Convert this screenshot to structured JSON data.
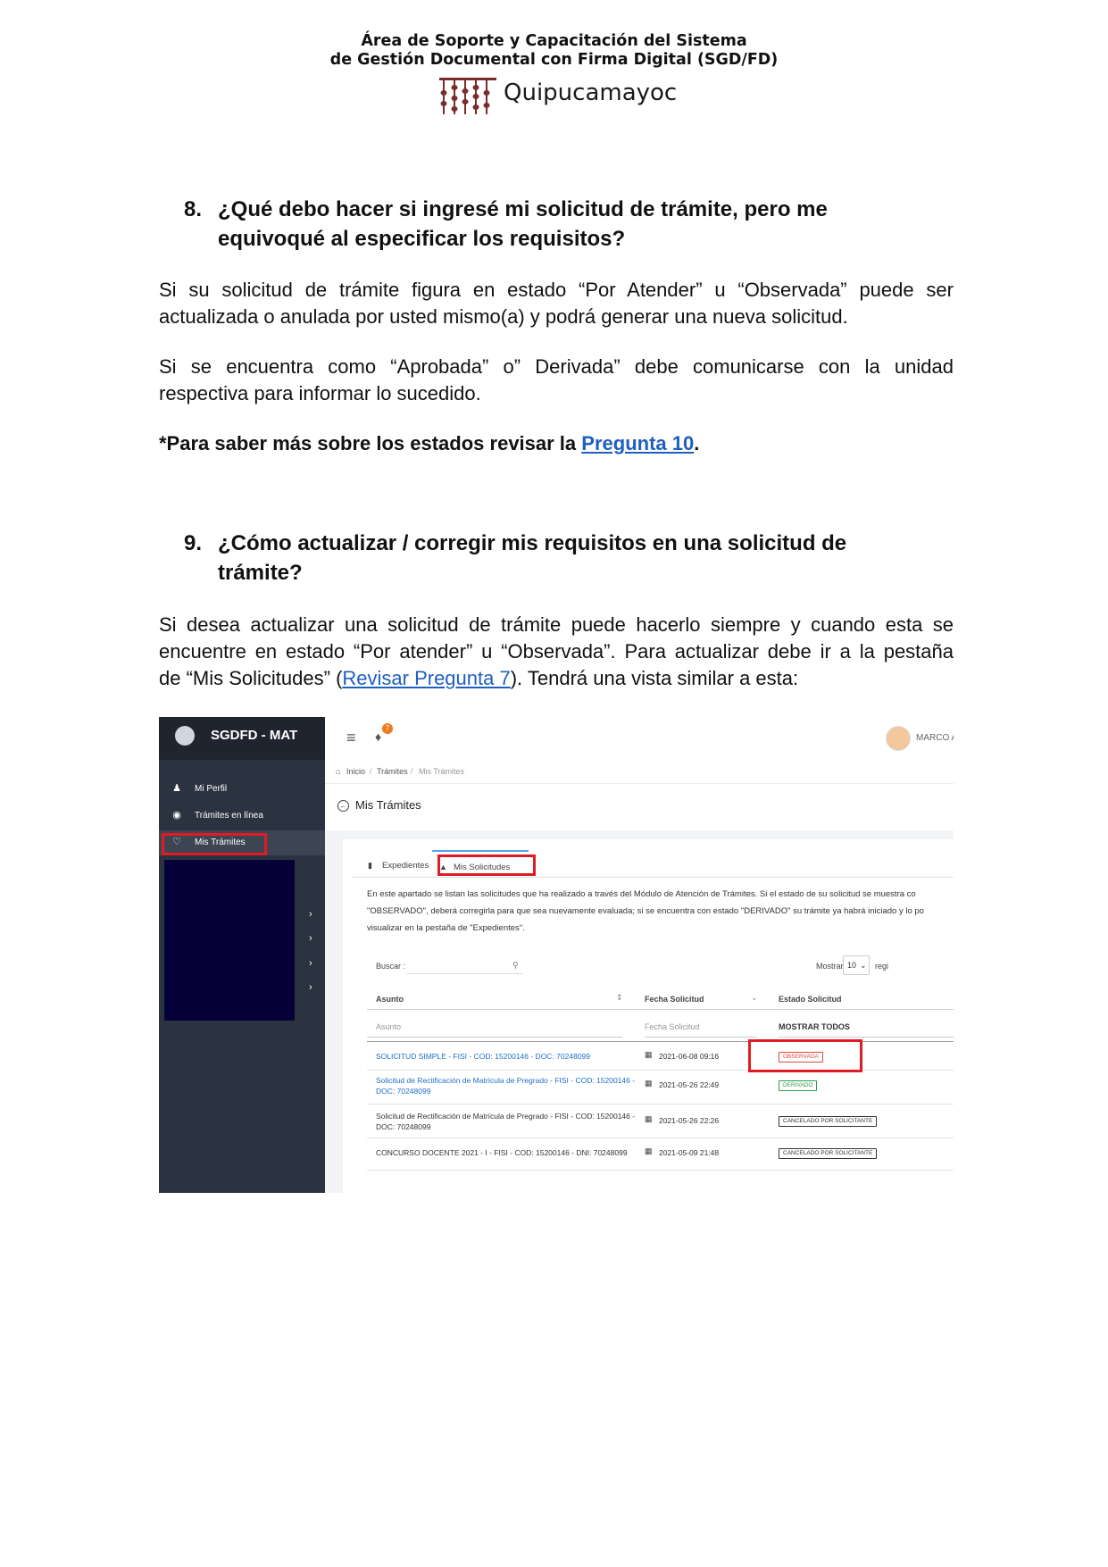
{
  "header": {
    "line1": "Área de Soporte y Capacitación del Sistema",
    "line2": "de Gestión Documental con Firma Digital (SGD/FD)",
    "logo_text": "Quipucamayoc"
  },
  "q8": {
    "number": "8.",
    "title": "¿Qué debo hacer si ingresé mi solicitud de trámite, pero me equivoqué al especificar los requisitos?",
    "p1_l1": "Si su solicitud de trámite figura en estado “Por Atender” u “Observada” puede ser",
    "p1_l2": "actualizada o anulada por usted mismo(a) y podrá generar una nueva solicitud.",
    "p2_l1": "Si se encuentra como “Aprobada” o” Derivada” debe comunicarse con la unidad",
    "p2_l2": "respectiva para informar lo sucedido.",
    "note_prefix": "*Para saber más sobre los estados revisar la ",
    "note_link": "Pregunta 10",
    "note_suffix": "."
  },
  "q9": {
    "number": "9.",
    "title": "¿Cómo actualizar / corregir mis requisitos en una solicitud de trámite?",
    "p1_l1": "Si desea actualizar una solicitud de trámite puede hacerlo siempre y cuando esta se",
    "p1_l2": "encuentre en estado “Por atender” u “Observada”. Para actualizar debe ir a la pestaña",
    "p1_l3_prefix": "de “Mis Solicitudes” (",
    "p1_l3_link": "Revisar Pregunta 7",
    "p1_l3_suffix": "). Tendrá una vista similar a esta:"
  },
  "screenshot": {
    "app_title": "SGDFD - MAT",
    "user_name": "MARCO AN",
    "notif_count": "7",
    "sidebar": [
      {
        "icon": "user-icon",
        "label": "Mi Perfil"
      },
      {
        "icon": "globe-icon",
        "label": "Trámites en línea"
      },
      {
        "icon": "sitemap-icon",
        "label": "Mis Trámites"
      }
    ],
    "breadcrumb": [
      "Inicio",
      "Trámites",
      "Mis Trámites"
    ],
    "page_title": "Mis Trámites",
    "tabs": [
      "Expedientes",
      "Mis Solicitudes"
    ],
    "intro_l1": "En este apartado se listan las solicitudes que ha realizado a través del Módulo de Atención de Trámites. Si el estado de su solicitud se muestra co",
    "intro_l2": "\"OBSERVADO\", deberá corregirla para que sea nuevamente evaluada; si se encuentra con estado \"DERIVADO\" su trámite ya habrá iniciado y lo po",
    "intro_l3": "visualizar en la pestaña de \"Expedientes\".",
    "search_label": "Buscar :",
    "show_label": "Mostrar",
    "show_value": "10",
    "records_label": "regi",
    "columns": [
      "Asunto",
      "Fecha Solicitud",
      "Estado Solicitud"
    ],
    "filters": [
      "Asunto",
      "Fecha Solicitud",
      "MOSTRAR TODOS"
    ],
    "rows": [
      {
        "asunto_l1": "SOLICITUD SIMPLE - FISI - COD: 15200146 - DOC: 70248099",
        "asunto_l2": "",
        "fecha": "2021-06-08 09:16",
        "estado": "OBSERVADA",
        "estado_color": "#e0483c",
        "link": true
      },
      {
        "asunto_l1": "Solicitud de Rectificación de Matrícula de Pregrado - FISI - COD: 15200146 -",
        "asunto_l2": "DOC: 70248099",
        "fecha": "2021-05-26 22:49",
        "estado": "DERIVADO",
        "estado_color": "#2e9a4b",
        "link": true
      },
      {
        "asunto_l1": "Solicitud de Rectificación de Matrícula de Pregrado - FISI - COD: 15200146 -",
        "asunto_l2": "DOC: 70248099",
        "fecha": "2021-05-26 22:26",
        "estado": "CANCELADO POR SOLICITANTE",
        "estado_color": "#333333",
        "link": false
      },
      {
        "asunto_l1": "CONCURSO DOCENTE 2021 - I - FISI - COD: 15200146 - DNI: 70248099",
        "asunto_l2": "",
        "fecha": "2021-05-09 21:48",
        "estado": "CANCELADO POR SOLICITANTE",
        "estado_color": "#333333",
        "link": false
      }
    ]
  }
}
